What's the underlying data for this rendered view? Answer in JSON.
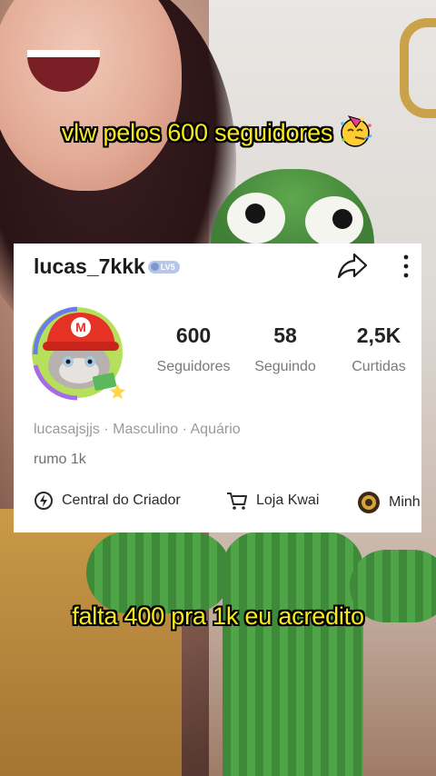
{
  "captions": {
    "top": "vlw pelos 600 seguidores",
    "bottom": "falta 400 pra 1k eu acredito"
  },
  "icons": {
    "top_caption_emoji": "partying-face-emoji",
    "share": "share-icon",
    "more": "more-vertical-icon",
    "creator_center": "creator-center-icon",
    "shop": "shopping-cart-icon",
    "third_item": "coin-icon"
  },
  "profile": {
    "username": "lucas_7kkk",
    "level_badge": "LV5",
    "stats": [
      {
        "value": "600",
        "label": "Seguidores"
      },
      {
        "value": "58",
        "label": "Seguindo"
      },
      {
        "value": "2,5K",
        "label": "Curtidas"
      }
    ],
    "details": "lucasajsjjs · Masculino · Aquário",
    "bio": "rumo 1k",
    "quick_links": [
      {
        "label": "Central do Criador"
      },
      {
        "label": "Loja Kwai"
      },
      {
        "label": "Minh"
      }
    ]
  },
  "colors": {
    "caption_text": "#f7e91a",
    "card_background": "#ffffff",
    "level_badge": "#b8c6e8"
  }
}
